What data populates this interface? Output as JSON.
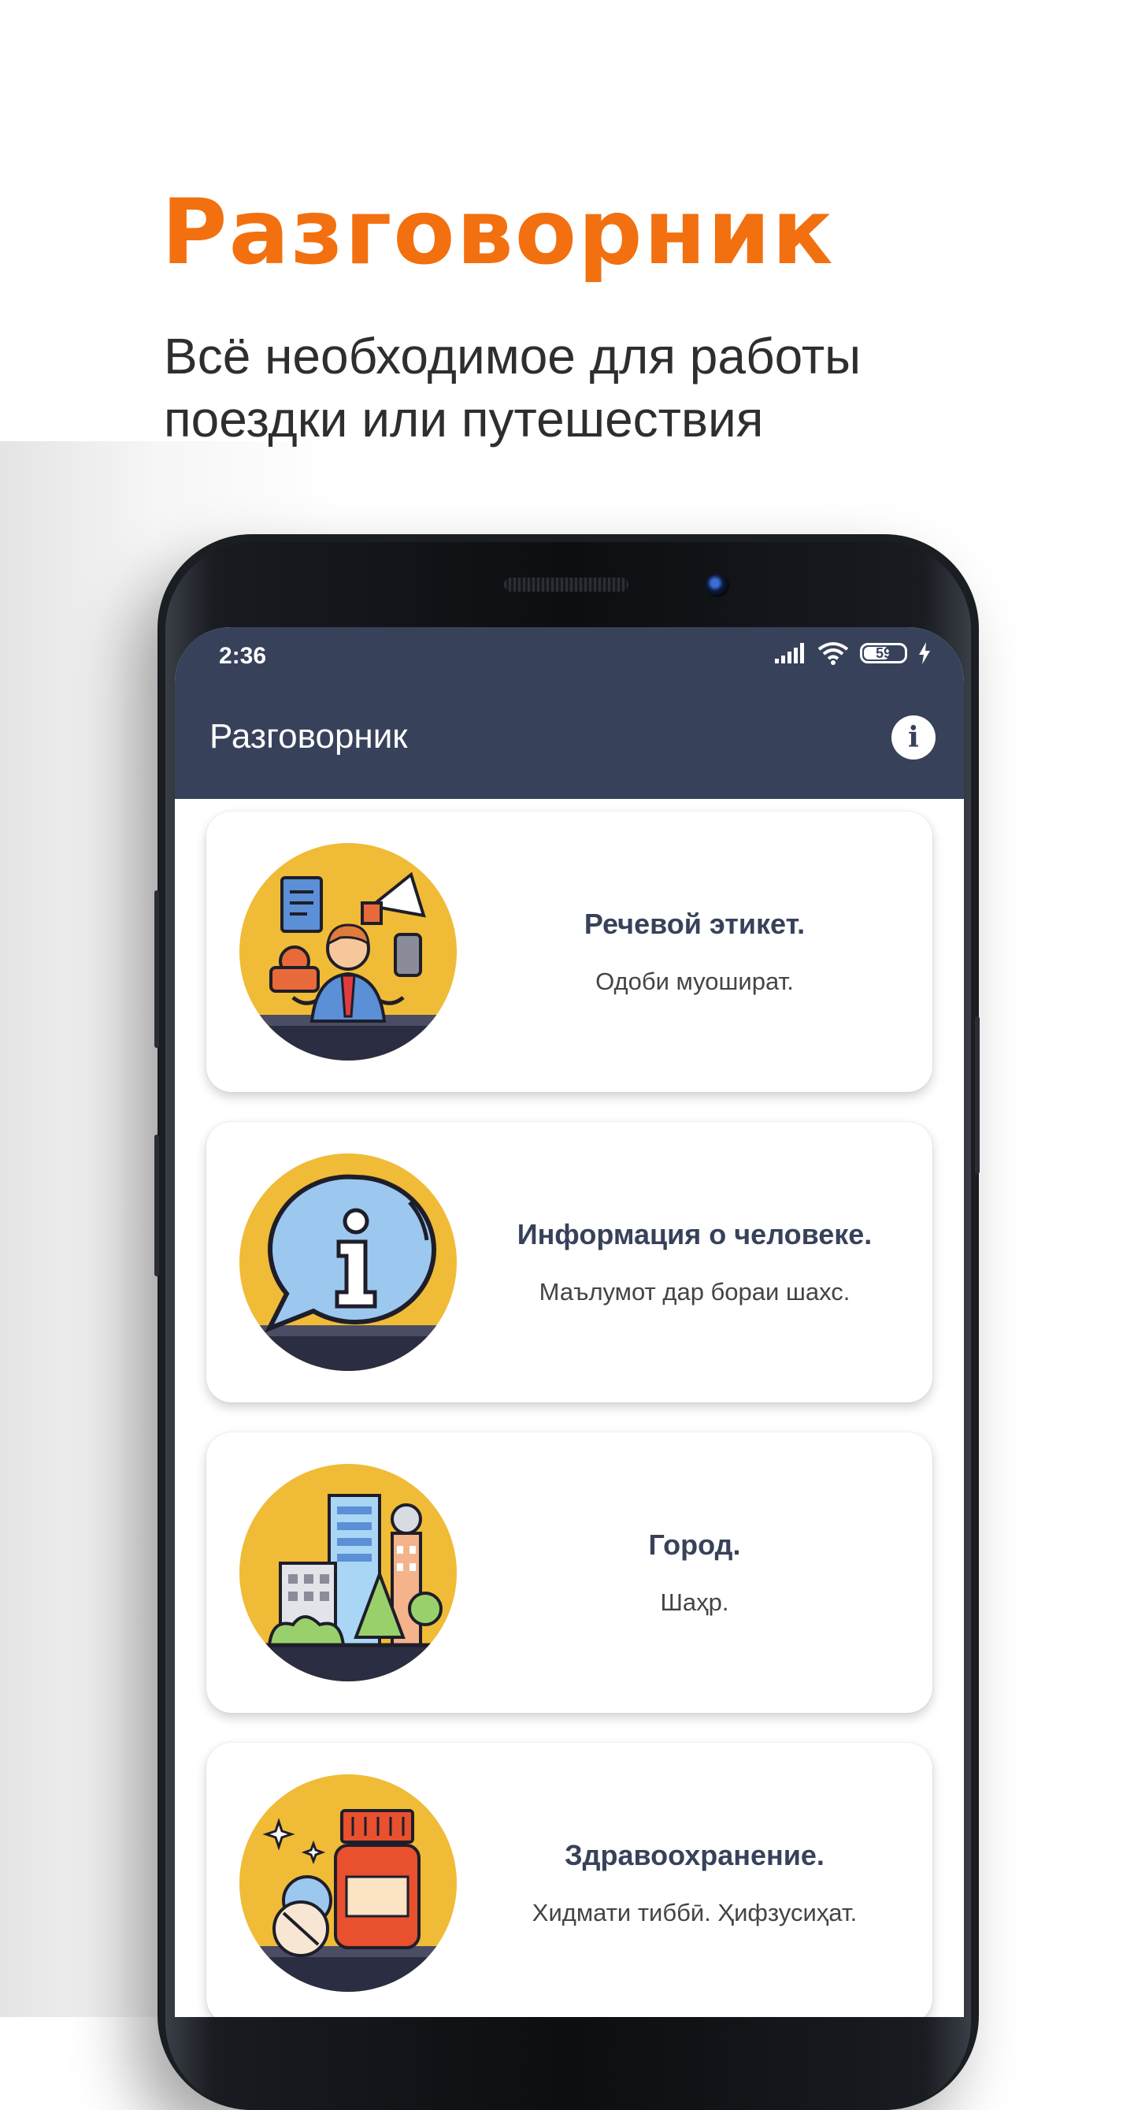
{
  "promo": {
    "title": "Разговорник",
    "subtitle": "Всё необходимое для работы поездки или путешествия"
  },
  "status_bar": {
    "time": "2:36",
    "battery": "59",
    "icons": [
      "signal-icon",
      "wifi-icon",
      "battery-icon",
      "charging-icon"
    ]
  },
  "app_bar": {
    "title": "Разговорник",
    "info_icon_glyph": "i"
  },
  "categories": [
    {
      "title": "Речевой этикет.",
      "subtitle": "Одоби муошират.",
      "icon": "business-person-icon"
    },
    {
      "title": "Информация о человеке.",
      "subtitle": "Маълумот дар бораи шахс.",
      "icon": "info-bubble-icon"
    },
    {
      "title": "Город.",
      "subtitle": "Шаҳр.",
      "icon": "city-icon"
    },
    {
      "title": "Здравоохранение.",
      "subtitle": "Хидмати тиббӣ. Ҳифзусиҳат.",
      "icon": "medicine-icon"
    }
  ],
  "colors": {
    "accent": "#f2700f",
    "app_bar": "#37425a",
    "icon_circle": "#f0bb36",
    "icon_base": "#2b2d42"
  }
}
